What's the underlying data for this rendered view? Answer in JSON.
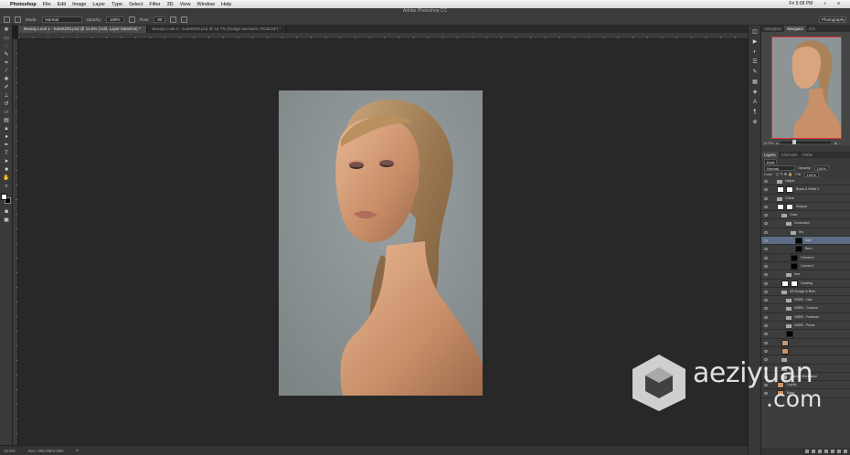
{
  "menubar": {
    "apple": "",
    "app": "Photoshop",
    "items": [
      "File",
      "Edit",
      "Image",
      "Layer",
      "Type",
      "Select",
      "Filter",
      "3D",
      "View",
      "Window",
      "Help"
    ],
    "clock": "Fri 5:08 PM"
  },
  "window_title": "Adobe Photoshop CC",
  "options": {
    "mode_label": "Mode:",
    "mode_value": "Normal",
    "opacity_label": "Opacity:",
    "opacity_value": "100%",
    "flow_label": "Flow:",
    "flow_value": "80",
    "workspace": "Photography"
  },
  "tabs": [
    {
      "label": "Beauty Look 1 - Kate6293.psd @ 12.5% (Add, Layer Mask/16) *",
      "active": true
    },
    {
      "label": "Beauty Look 2 - Kate6293.psd @ 16.7% (Dodge and Burn, RGB/16*) *",
      "active": false
    }
  ],
  "status": {
    "zoom": "12.5%",
    "doc": "Doc: 205.0M/3.25G"
  },
  "navigator": {
    "tabs": [
      "Histogram",
      "Navigator",
      "Info"
    ],
    "active_tab": "Navigator",
    "zoom": "12.5%",
    "zoom_fraction": 0.25
  },
  "layers_panel": {
    "tabs": [
      "Layers",
      "Channels",
      "Paths"
    ],
    "active_tab": "Layers",
    "kind": "Kind",
    "blend": "Normal",
    "opacity_label": "Opacity:",
    "opacity_value": "100%",
    "lock_label": "Lock:",
    "fill_label": "Fill:",
    "fill_value": "100%",
    "layers": [
      {
        "name": "Helper",
        "indent": 1,
        "type": "folder",
        "selected": false
      },
      {
        "name": "Black & White 1",
        "indent": 1,
        "type": "adjust",
        "selected": false
      },
      {
        "name": "Check",
        "indent": 1,
        "type": "folder",
        "selected": false
      },
      {
        "name": "Subject",
        "indent": 1,
        "type": "mask",
        "selected": false
      },
      {
        "name": "Color",
        "indent": 2,
        "type": "folder",
        "selected": false
      },
      {
        "name": "Correction",
        "indent": 3,
        "type": "folder",
        "selected": false
      },
      {
        "name": "Iris",
        "indent": 4,
        "type": "folder",
        "selected": false
      },
      {
        "name": "Add",
        "indent": 5,
        "type": "black",
        "selected": true
      },
      {
        "name": "Burn",
        "indent": 5,
        "type": "black",
        "selected": false
      },
      {
        "name": "Curves 6",
        "indent": 4,
        "type": "black",
        "selected": false
      },
      {
        "name": "Curves 3",
        "indent": 4,
        "type": "black",
        "selected": false
      },
      {
        "name": "Iron",
        "indent": 3,
        "type": "folder",
        "selected": false
      },
      {
        "name": "Grading",
        "indent": 2,
        "type": "adjust",
        "selected": false
      },
      {
        "name": "VB Dodge & Burn",
        "indent": 2,
        "type": "folder",
        "selected": false
      },
      {
        "name": "VBDB - Hair",
        "indent": 3,
        "type": "folder",
        "selected": false
      },
      {
        "name": "VBDB - Contour",
        "indent": 3,
        "type": "folder",
        "selected": false
      },
      {
        "name": "VBDB - Features",
        "indent": 3,
        "type": "folder",
        "selected": false
      },
      {
        "name": "VBDB - Pores",
        "indent": 3,
        "type": "folder",
        "selected": false
      },
      {
        "name": "",
        "indent": 3,
        "type": "black",
        "selected": false
      },
      {
        "name": "",
        "indent": 2,
        "type": "skin",
        "selected": false
      },
      {
        "name": "",
        "indent": 2,
        "type": "skin",
        "selected": false
      },
      {
        "name": "",
        "indent": 2,
        "type": "folder",
        "selected": false
      },
      {
        "name": "",
        "indent": 2,
        "type": "folder",
        "selected": false
      },
      {
        "name": "Frames Workplace",
        "indent": 2,
        "type": "folder",
        "selected": false
      },
      {
        "name": "Liquify",
        "indent": 1,
        "type": "skin",
        "selected": false
      },
      {
        "name": "Base",
        "indent": 1,
        "type": "skin",
        "selected": false
      }
    ]
  },
  "watermark": {
    "text": "aeziyuan",
    "sub": ".com"
  }
}
